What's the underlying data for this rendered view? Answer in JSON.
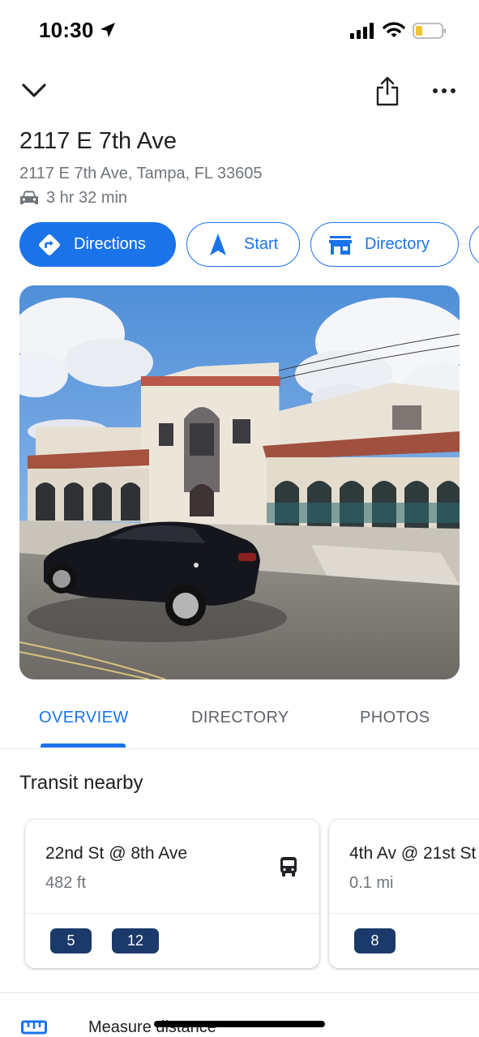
{
  "status_bar": {
    "time": "10:30",
    "icons": [
      "location-arrow-icon",
      "cellular-signal-icon",
      "wifi-icon",
      "battery-low-icon"
    ],
    "battery_color": "#f2c230"
  },
  "toolbar": {
    "icons": [
      "chevron-down-icon",
      "share-icon",
      "more-options-icon"
    ]
  },
  "place": {
    "title": "2117 E 7th Ave",
    "address": "2117 E 7th Ave, Tampa, FL 33605",
    "drive_time": "3 hr 32 min",
    "drive_icon": "car-icon"
  },
  "actions": [
    {
      "label": "Directions",
      "icon": "directions-diamond-icon",
      "primary": true
    },
    {
      "label": "Start",
      "icon": "navigation-arrow-icon",
      "primary": false
    },
    {
      "label": "Directory",
      "icon": "storefront-icon",
      "primary": false
    }
  ],
  "photo": {
    "subject": "street-view-image",
    "icon": "street-view-photo"
  },
  "tabs": [
    {
      "label": "OVERVIEW",
      "active": true
    },
    {
      "label": "DIRECTORY",
      "active": false
    },
    {
      "label": "PHOTOS",
      "active": false
    }
  ],
  "transit": {
    "title": "Transit nearby",
    "cards": [
      {
        "stop": "22nd St @ 8th Ave",
        "distance": "482 ft",
        "routes": [
          "5",
          "12"
        ]
      },
      {
        "stop": "4th Av @ 21st St",
        "distance": "0.1 mi",
        "routes": [
          "8"
        ]
      }
    ]
  },
  "bottom": {
    "measure_label": "Measure distance",
    "ruler_icon": "ruler-icon"
  },
  "colors": {
    "accent": "#1a73e8",
    "route_badge": "#1b3a6b",
    "secondary_text": "#70757a"
  }
}
